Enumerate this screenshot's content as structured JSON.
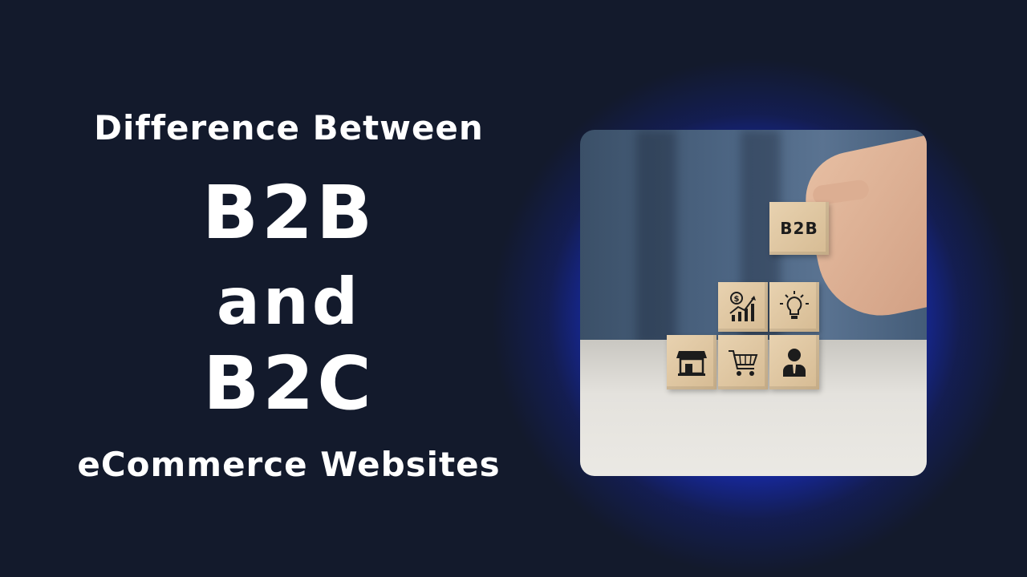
{
  "headline": {
    "line1": "Difference Between",
    "line2": "B2B",
    "line3": "and",
    "line4": "B2C",
    "line5": "eCommerce Websites"
  },
  "photo": {
    "cube_label": "B2B",
    "icons": [
      "dollar-growth-chart-icon",
      "lightbulb-icon",
      "shop-icon",
      "shopping-cart-icon",
      "businessman-icon"
    ]
  }
}
